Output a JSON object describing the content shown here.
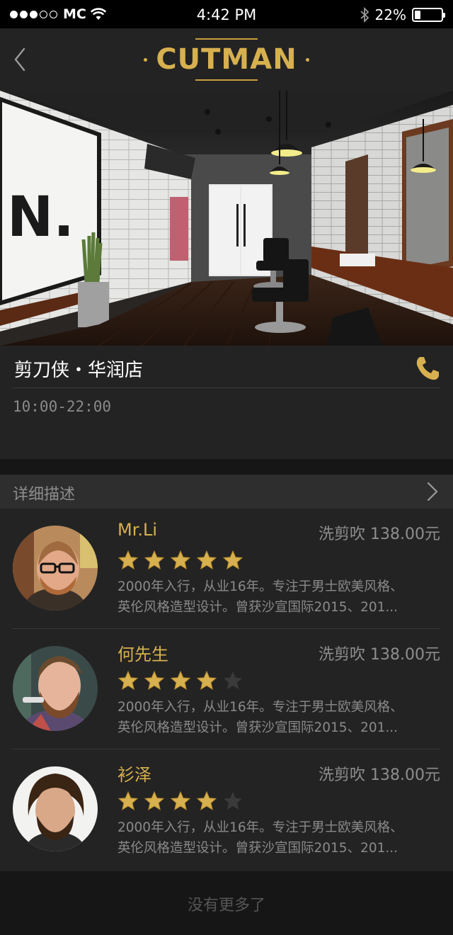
{
  "status_bar": {
    "carrier": "MC",
    "time": "4:42 PM",
    "battery": "22%",
    "battery_level": 0.22,
    "signal_bars_filled": 3,
    "signal_bars_total": 5
  },
  "nav": {
    "logo": "CUTMAN"
  },
  "store": {
    "name": "剪刀侠・华润店",
    "hours": "10:00-22:00"
  },
  "description": {
    "title": "详细描述"
  },
  "barbers": [
    {
      "name": "Mr.Li",
      "service": "洗剪吹 138.00元",
      "rating": 5,
      "bio_line1": "2000年入行，从业16年。专注于男士欧美风格、",
      "bio_line2": "英伦风格造型设计。曾获沙宣国际2015、201..."
    },
    {
      "name": "何先生",
      "service": "洗剪吹 138.00元",
      "rating": 4,
      "bio_line1": "2000年入行，从业16年。专注于男士欧美风格、",
      "bio_line2": "英伦风格造型设计。曾获沙宣国际2015、201..."
    },
    {
      "name": "衫泽",
      "service": "洗剪吹 138.00元",
      "rating": 4,
      "bio_line1": "2000年入行，从业16年。专注于男士欧美风格、",
      "bio_line2": "英伦风格造型设计。曾获沙宣国际2015、201..."
    }
  ],
  "footer": {
    "text": "没有更多了"
  },
  "colors": {
    "accent_gold": "#d7b04f",
    "background": "#232323",
    "muted_text": "#8e8e8e"
  }
}
